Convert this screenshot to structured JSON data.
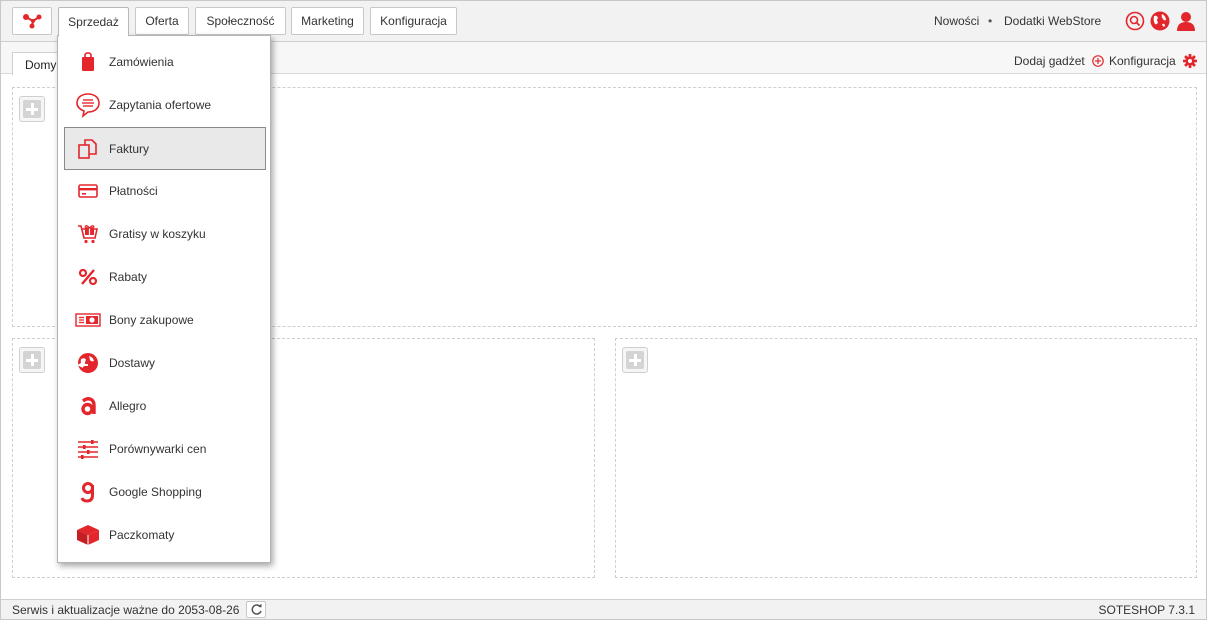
{
  "nav": {
    "tabs": [
      {
        "label": "Sprzedaż",
        "active": true
      },
      {
        "label": "Oferta"
      },
      {
        "label": "Społeczność"
      },
      {
        "label": "Marketing"
      },
      {
        "label": "Konfiguracja"
      }
    ],
    "links": {
      "news": "Nowości",
      "separator": "•",
      "addons": "Dodatki WebStore"
    },
    "icons": [
      "search-icon",
      "globe-icon",
      "user-icon"
    ]
  },
  "subbar": {
    "home_tab": "Domy",
    "add_gadget": "Dodaj gadżet",
    "configuration": "Konfiguracja"
  },
  "dropdown": {
    "items": [
      {
        "label": "Zamówienia",
        "icon": "shopping-bag-icon"
      },
      {
        "label": "Zapytania ofertowe",
        "icon": "chat-bubble-icon"
      },
      {
        "label": "Faktury",
        "icon": "documents-icon",
        "highlighted": true
      },
      {
        "label": "Płatności",
        "icon": "credit-card-icon"
      },
      {
        "label": "Gratisy w koszyku",
        "icon": "gift-cart-icon"
      },
      {
        "label": "Rabaty",
        "icon": "percent-icon"
      },
      {
        "label": "Bony zakupowe",
        "icon": "voucher-icon"
      },
      {
        "label": "Dostawy",
        "icon": "globe-delivery-icon"
      },
      {
        "label": "Allegro",
        "icon": "allegro-icon"
      },
      {
        "label": "Porównywarki cen",
        "icon": "sliders-icon"
      },
      {
        "label": "Google Shopping",
        "icon": "google-g-icon"
      },
      {
        "label": "Paczkomaty",
        "icon": "parcel-locker-icon"
      }
    ]
  },
  "footer": {
    "service_text": "Serwis i aktualizacje ważne do 2053-08-26",
    "version": "SOTESHOP 7.3.1"
  },
  "colors": {
    "accent": "#e3262c",
    "border": "#c8c8c8",
    "highlight_bg": "#e9e9e9"
  }
}
